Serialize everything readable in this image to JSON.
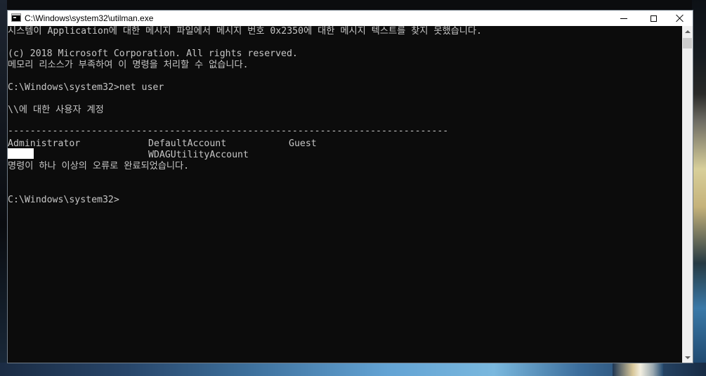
{
  "window": {
    "title": "C:\\Windows\\system32\\utilman.exe",
    "minimize_icon": "minimize-icon",
    "maximize_icon": "maximize-icon",
    "close_icon": "close-icon"
  },
  "console": {
    "lines": [
      "시스템이 Application에 대한 메시지 파일에서 메시지 번호 0x2350에 대한 메시지 텍스트를 찾지 못했습니다.",
      "",
      "(c) 2018 Microsoft Corporation. All rights reserved.",
      "메모리 리소스가 부족하여 이 명령을 처리할 수 없습니다.",
      "",
      "C:\\Windows\\system32>net user",
      "",
      "\\\\에 대한 사용자 계정",
      "",
      "-------------------------------------------------------------------------------"
    ],
    "accounts": [
      "Administrator",
      "DefaultAccount",
      "Guest",
      "",
      "WDAGUtilityAccount"
    ],
    "result": "명령이 하나 이상의 오류로 완료되었습니다.",
    "prompt": "C:\\Windows\\system32>"
  }
}
